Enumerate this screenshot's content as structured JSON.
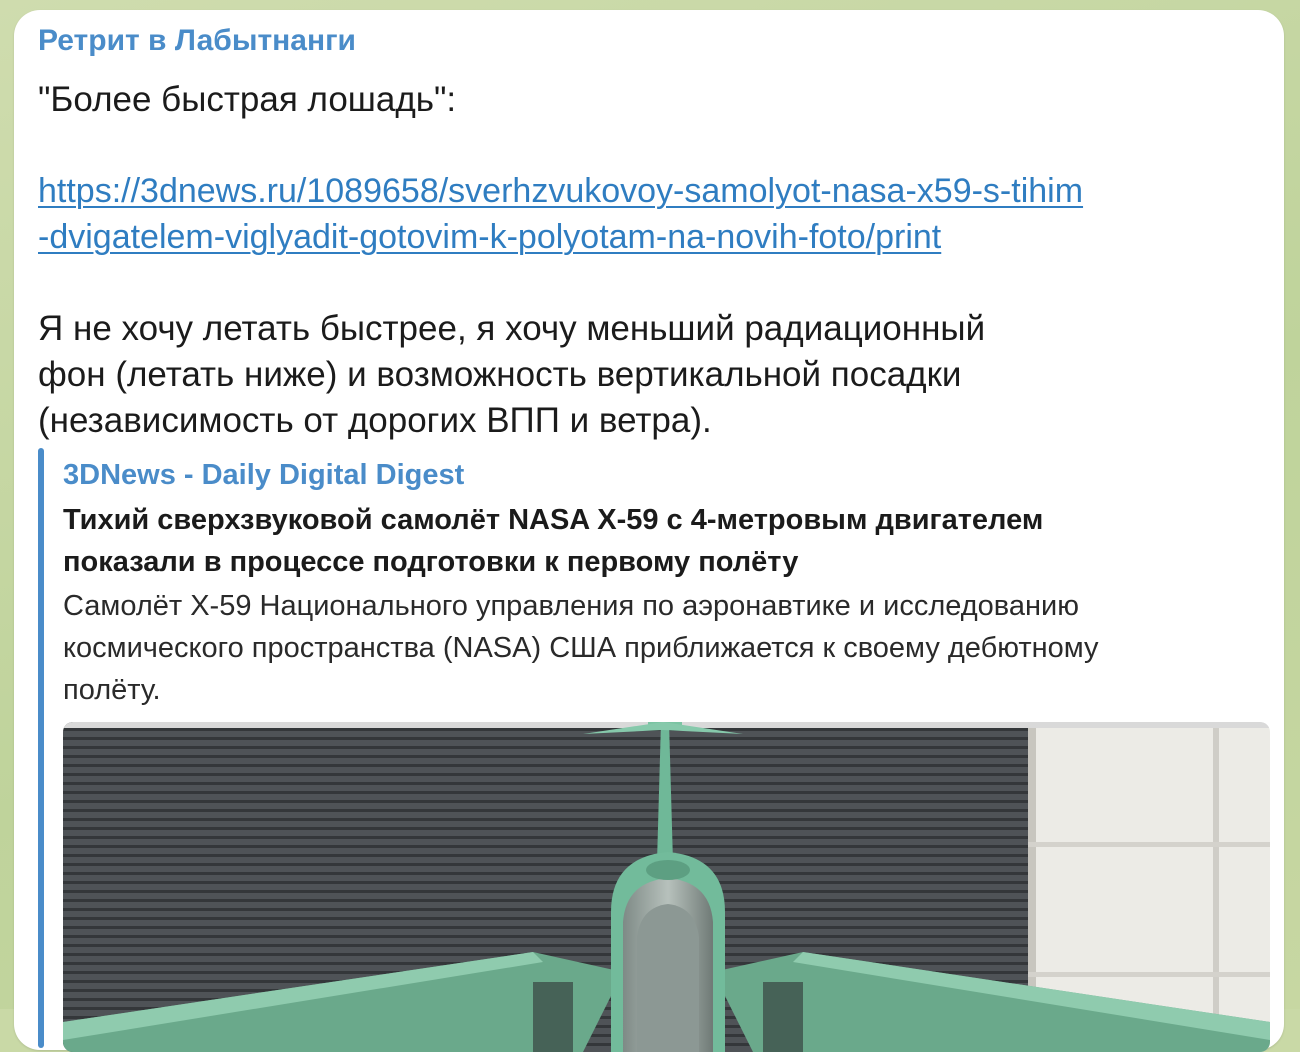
{
  "message": {
    "sender": "Ретрит в Лабытнанги",
    "title_line": "\"Более быстрая лошадь\":",
    "link": {
      "line1": "https://3dnews.ru/1089658/sverhzvukovoy-samolyot-nasa-x59-s-tihim",
      "line2": "-dvigatelem-viglyadit-gotovim-k-polyotam-na-novih-foto/print"
    },
    "body_lines": [
      "Я не хочу летать быстрее, я хочу меньший радиационный",
      "фон (летать ниже) и возможность вертикальной посадки",
      "(независимость от дорогих ВПП и ветра)."
    ]
  },
  "link_preview": {
    "site_name": "3DNews - Daily Digital Digest",
    "title_lines": [
      "Тихий сверхзвуковой самолёт NASA X-59 с 4-метровым двигателем",
      "показали в процессе подготовки к первому полёту"
    ],
    "description_lines": [
      "Самолёт X-59 Национального управления по аэронавтике и исследованию",
      "космического пространства (NASA) США приближается к своему дебютному",
      "полёту."
    ],
    "image": "aircraft-photo"
  },
  "colors": {
    "accent": "#4a8cc9",
    "link": "#2f7dc1",
    "text": "#1b1b1b",
    "background": "#c9d9a6",
    "bubble": "#ffffff"
  }
}
